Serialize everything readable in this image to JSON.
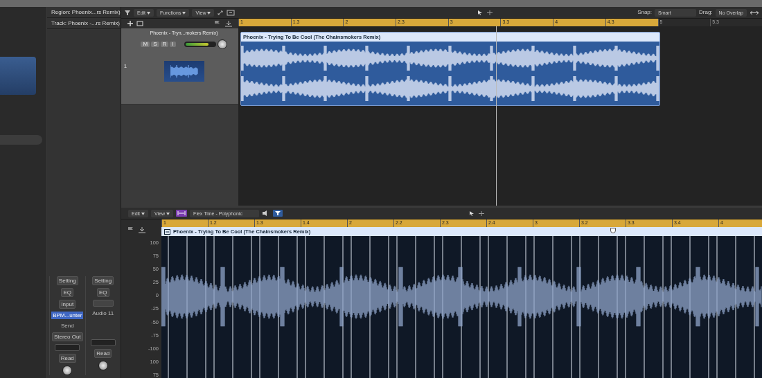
{
  "inspector": {
    "sections": [
      "Region: Phoenix...rs Remix)",
      "Track: Phoenix -...rs Remix)"
    ]
  },
  "channel_strips": [
    {
      "setting": "Setting",
      "eq": "EQ",
      "input": "Input",
      "name": "BPM...unter",
      "name_selected": true,
      "send": "Send",
      "output": "Stereo Out",
      "automation": "Read"
    },
    {
      "setting": "Setting",
      "eq": "EQ",
      "name": "Audio 11",
      "name_selected": false,
      "automation": "Read"
    }
  ],
  "toolbar": {
    "menus": [
      "Edit",
      "Functions",
      "View"
    ],
    "snap_label": "Snap:",
    "snap_value": "Smart",
    "drag_label": "Drag:",
    "drag_value": "No Overlap"
  },
  "ruler": {
    "ticks": [
      {
        "label": "1",
        "in_cycle": true
      },
      {
        "label": "1.3",
        "in_cycle": true
      },
      {
        "label": "2",
        "in_cycle": true
      },
      {
        "label": "2.3",
        "in_cycle": true
      },
      {
        "label": "3",
        "in_cycle": true
      },
      {
        "label": "3.3",
        "in_cycle": true
      },
      {
        "label": "4",
        "in_cycle": true
      },
      {
        "label": "4.3",
        "in_cycle": true
      },
      {
        "label": "5",
        "in_cycle": false
      },
      {
        "label": "5.3",
        "in_cycle": false
      }
    ]
  },
  "tracks": [
    {
      "number": "1",
      "name": "Phoenix - Tryn...mokers Remix)",
      "buttons": [
        "M",
        "S",
        "R",
        "I"
      ],
      "level": 0.8,
      "region_title": "Phoenix - Trying To Be Cool (The Chainsmokers Remix)",
      "region_selected": true
    }
  ],
  "editor": {
    "menus": [
      "Edit",
      "View"
    ],
    "flex_mode": "Flex Time - Polyphonic",
    "ruler": [
      "1",
      "1.2",
      "1.3",
      "1.4",
      "2",
      "2.2",
      "2.3",
      "2.4",
      "3",
      "3.2",
      "3.3",
      "3.4",
      "4"
    ],
    "region_title": "Phoenix - Trying To Be Cool (The Chainsmokers Remix)",
    "amplitude_labels": [
      "100",
      "75",
      "50",
      "25",
      "0",
      "-25",
      "-50",
      "-75",
      "-100",
      "100",
      "75"
    ]
  }
}
